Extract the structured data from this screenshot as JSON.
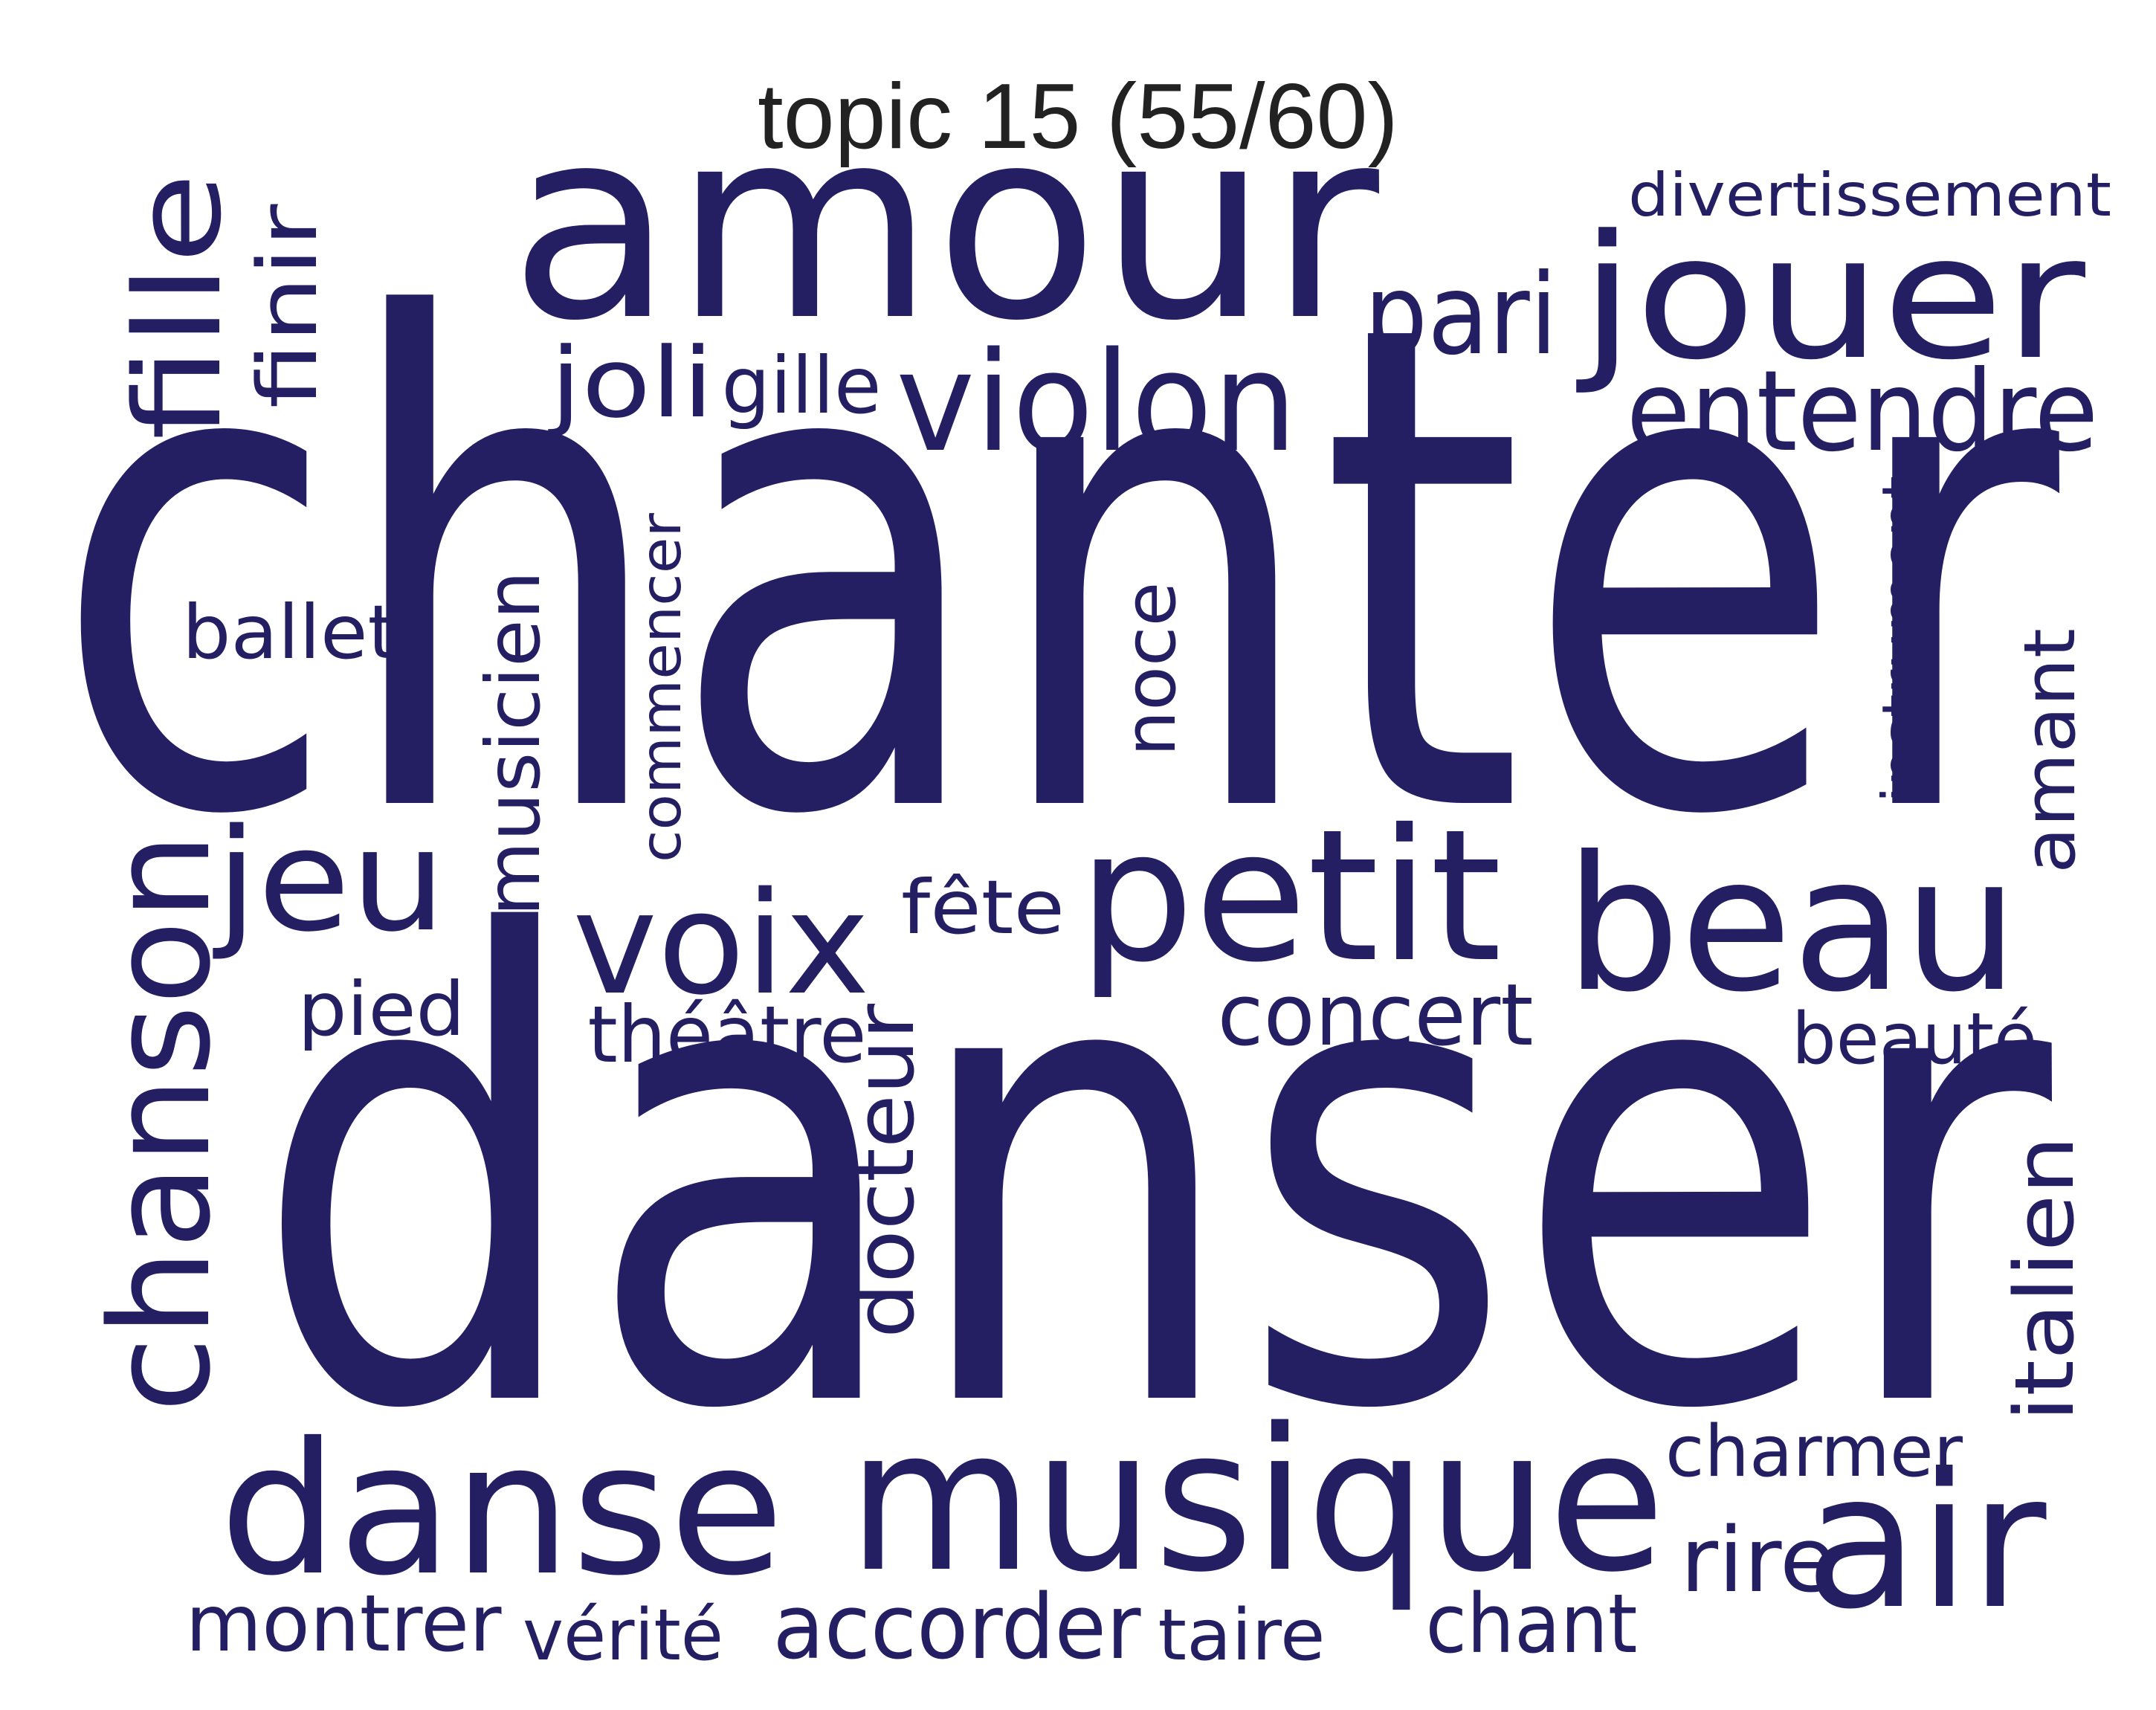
{
  "title": "topic 15 (55/60)",
  "word_color": "#241f63",
  "words": [
    {
      "text": "chanter"
    },
    {
      "text": "danser"
    },
    {
      "text": "amour"
    },
    {
      "text": "musique"
    },
    {
      "text": "danse"
    },
    {
      "text": "petit"
    },
    {
      "text": "beau"
    },
    {
      "text": "jouer"
    },
    {
      "text": "air"
    },
    {
      "text": "chanson"
    },
    {
      "text": "violon"
    },
    {
      "text": "voix"
    },
    {
      "text": "fille"
    },
    {
      "text": "jeu"
    },
    {
      "text": "entendre"
    },
    {
      "text": "pari"
    },
    {
      "text": "joli"
    },
    {
      "text": "gille"
    },
    {
      "text": "finir"
    },
    {
      "text": "ballet"
    },
    {
      "text": "musicien"
    },
    {
      "text": "commencer"
    },
    {
      "text": "noce"
    },
    {
      "text": "instrument"
    },
    {
      "text": "amant"
    },
    {
      "text": "fête"
    },
    {
      "text": "concert"
    },
    {
      "text": "beauté"
    },
    {
      "text": "pied"
    },
    {
      "text": "théâtre"
    },
    {
      "text": "docteur"
    },
    {
      "text": "italien"
    },
    {
      "text": "charmer"
    },
    {
      "text": "rire"
    },
    {
      "text": "montrer"
    },
    {
      "text": "vérité"
    },
    {
      "text": "accorder"
    },
    {
      "text": "taire"
    },
    {
      "text": "chant"
    },
    {
      "text": "divertissement"
    }
  ]
}
